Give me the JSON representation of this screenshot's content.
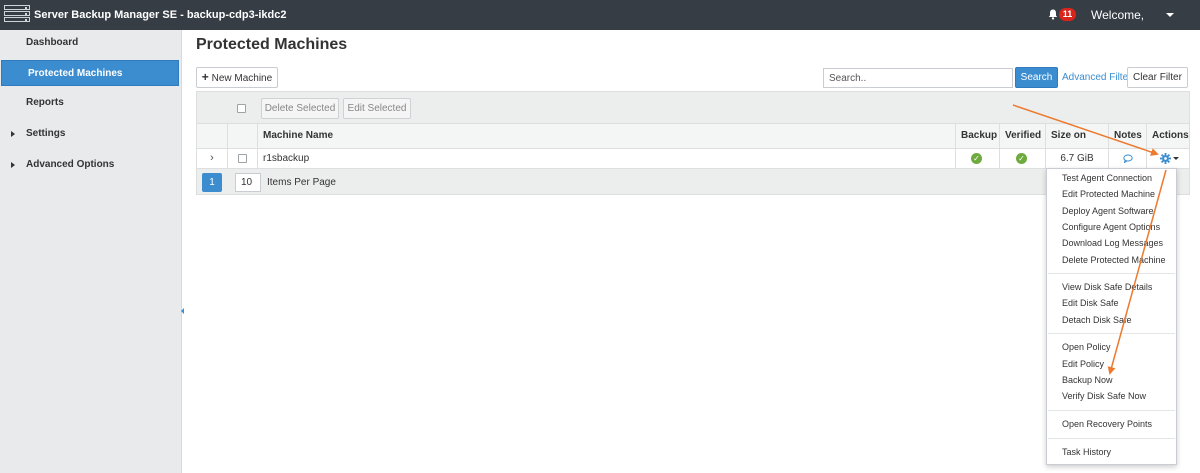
{
  "header": {
    "app_title": "Server Backup Manager SE - backup-cdp3-ikdc2",
    "notification_count": "11",
    "welcome": "Welcome,"
  },
  "sidebar": {
    "items": [
      {
        "label": "Dashboard",
        "active": false,
        "expandable": false
      },
      {
        "label": "Protected Machines",
        "active": true,
        "expandable": false
      },
      {
        "label": "Reports",
        "active": false,
        "expandable": false
      },
      {
        "label": "Settings",
        "active": false,
        "expandable": true
      },
      {
        "label": "Advanced Options",
        "active": false,
        "expandable": true
      }
    ]
  },
  "main": {
    "title": "Protected Machines",
    "new_machine_label": "New Machine",
    "search_placeholder": "Search..",
    "search_button": "Search",
    "advanced_filter": "Advanced Filter",
    "clear_filter": "Clear Filter",
    "delete_selected": "Delete Selected",
    "edit_selected": "Edit Selected",
    "columns": [
      "Machine Name",
      "Backup",
      "Verified",
      "Size on Disk",
      "Notes",
      "Actions"
    ],
    "rows": [
      {
        "machine_name": "r1sbackup",
        "backup": "ok",
        "verified": "ok",
        "size_on_disk": "6.7 GiB"
      }
    ],
    "pagination": {
      "current_page": "1",
      "items_per_page": "10",
      "items_per_page_label": "Items Per Page"
    }
  },
  "actions_menu": {
    "groups": [
      [
        "Test Agent Connection",
        "Edit Protected Machine",
        "Deploy Agent Software",
        "Configure Agent Options",
        "Download Log Messages",
        "Delete Protected Machine"
      ],
      [
        "View Disk Safe Details",
        "Edit Disk Safe",
        "Detach Disk Safe"
      ],
      [
        "Open Policy",
        "Edit Policy",
        "Backup Now",
        "Verify Disk Safe Now"
      ],
      [
        "Open Recovery Points"
      ],
      [
        "Task History"
      ]
    ]
  },
  "colors": {
    "topbar": "#363d45",
    "accent": "#3b8dd0",
    "success": "#6eaa3e",
    "badge": "#d9241c",
    "annotation": "#ec7a2f"
  }
}
